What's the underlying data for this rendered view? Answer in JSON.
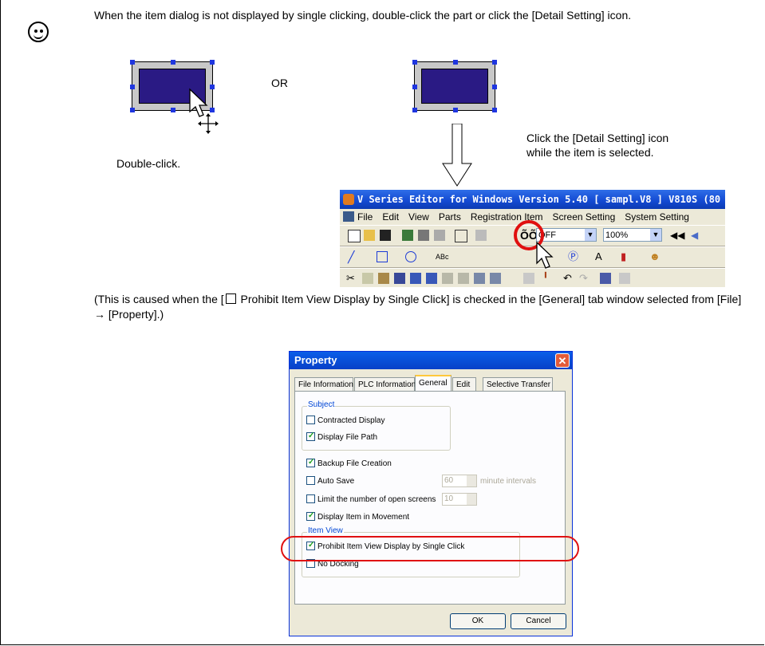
{
  "hint": {
    "text": "When the item dialog is not displayed by single clicking, double-click the part or click the [Detail Setting] icon."
  },
  "or_label": "OR",
  "double_click_label": "Double-click.",
  "detail_caption_1": "Click the [Detail Setting] icon",
  "detail_caption_2": "while the item is selected.",
  "editor": {
    "title": "V Series Editor for Windows Version 5.40 [ sampl.V8 ] V810S (80",
    "menu": [
      "File",
      "Edit",
      "View",
      "Parts",
      "Registration Item",
      "Screen Setting",
      "System Setting"
    ],
    "off_value": "OFF",
    "zoom_value": "100%"
  },
  "cause_note": {
    "prefix": "(This is caused when the [",
    "middle": " Prohibit Item View Display by Single Click] is checked in the [General] tab window selected from [File] → [Property].)"
  },
  "dialog": {
    "title": "Property",
    "close_glyph": "✕",
    "tabs": [
      "File Information",
      "PLC Information",
      "General",
      "Edit",
      "Selective Transfer"
    ],
    "active_tab": "General",
    "subject_group": "Subject",
    "contracted_display": "Contracted Display",
    "display_file_path": "Display File Path",
    "backup_file_creation": "Backup File Creation",
    "auto_save": "Auto Save",
    "auto_save_value": "60",
    "minute_intervals": "minute intervals",
    "limit_screens": "Limit the number of open screens",
    "limit_value": "10",
    "display_item_movement": "Display Item in Movement",
    "item_view_group": "Item View",
    "prohibit_single_click": "Prohibit Item View Display by Single Click",
    "no_docking": "No Docking",
    "ok_label": "OK",
    "cancel_label": "Cancel",
    "checked": {
      "contracted_display": false,
      "display_file_path": true,
      "backup_file_creation": true,
      "auto_save": false,
      "limit_screens": false,
      "display_item_movement": true,
      "prohibit_single_click": true,
      "no_docking": false
    }
  }
}
